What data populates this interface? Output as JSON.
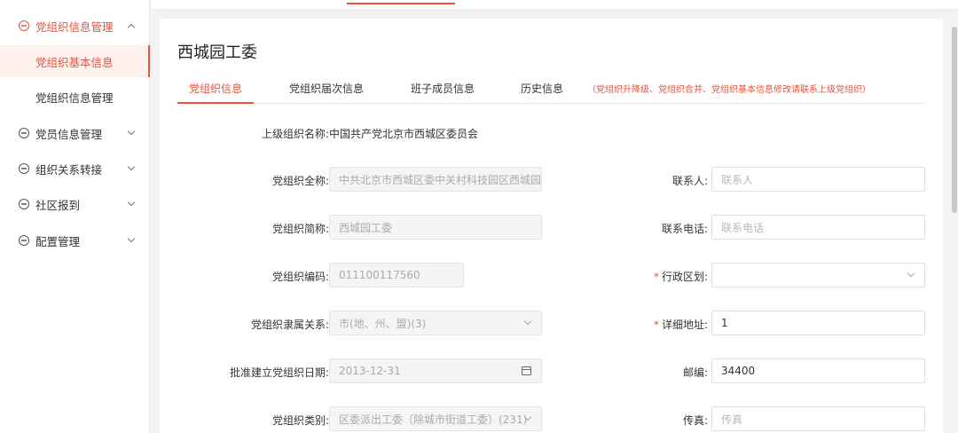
{
  "sidebar": {
    "items": [
      {
        "label": "党组织信息管理",
        "icon": "chat-bubble-icon",
        "state": "expanded"
      },
      {
        "label": "党组织基本信息",
        "state": "active"
      },
      {
        "label": "党组织信息管理"
      },
      {
        "label": "党员信息管理",
        "icon": "chat-bubble-icon"
      },
      {
        "label": "组织关系转接",
        "icon": "chat-bubble-icon"
      },
      {
        "label": "社区报到",
        "icon": "chat-bubble-icon"
      },
      {
        "label": "配置管理",
        "icon": "chat-bubble-icon"
      }
    ]
  },
  "page": {
    "title": "西城园工委",
    "tabs": [
      {
        "label": "党组织信息",
        "active": true
      },
      {
        "label": "党组织届次信息"
      },
      {
        "label": "班子成员信息"
      },
      {
        "label": "历史信息"
      }
    ],
    "tab_note": "（党组织升降级、党组织合并、党组织基本信息修改请联系上级党组织）"
  },
  "form": {
    "parent_org": {
      "label": "上级组织名称:",
      "value": "中国共产党北京市西城区委员会"
    },
    "full_name": {
      "label": "党组织全称:",
      "value": "中共北京市西城区委中关村科技园区西城园"
    },
    "short_name": {
      "label": "党组织简称:",
      "value": "西城园工委"
    },
    "code": {
      "label": "党组织编码:",
      "value": "011100117560"
    },
    "affiliation": {
      "label": "党组织隶属关系:",
      "value": "市(地、州、盟)(3)"
    },
    "approval_date": {
      "label": "批准建立党组织日期:",
      "value": "2013-12-31"
    },
    "category": {
      "label": "党组织类别:",
      "value": "区委派出工委（除城市街道工委）(231)"
    },
    "contact": {
      "label": "联系人:",
      "placeholder": "联系人"
    },
    "phone": {
      "label": "联系电话:",
      "placeholder": "联系电话"
    },
    "district": {
      "label": "行政区划:",
      "required": "*",
      "value": ""
    },
    "address": {
      "label": "详细地址:",
      "required": "*",
      "value": "1"
    },
    "postcode": {
      "label": "邮编:",
      "value": "34400"
    },
    "fax": {
      "label": "传真:",
      "placeholder": "传真"
    }
  },
  "colors": {
    "accent": "#e8533e",
    "background": "#f2f3f5"
  }
}
